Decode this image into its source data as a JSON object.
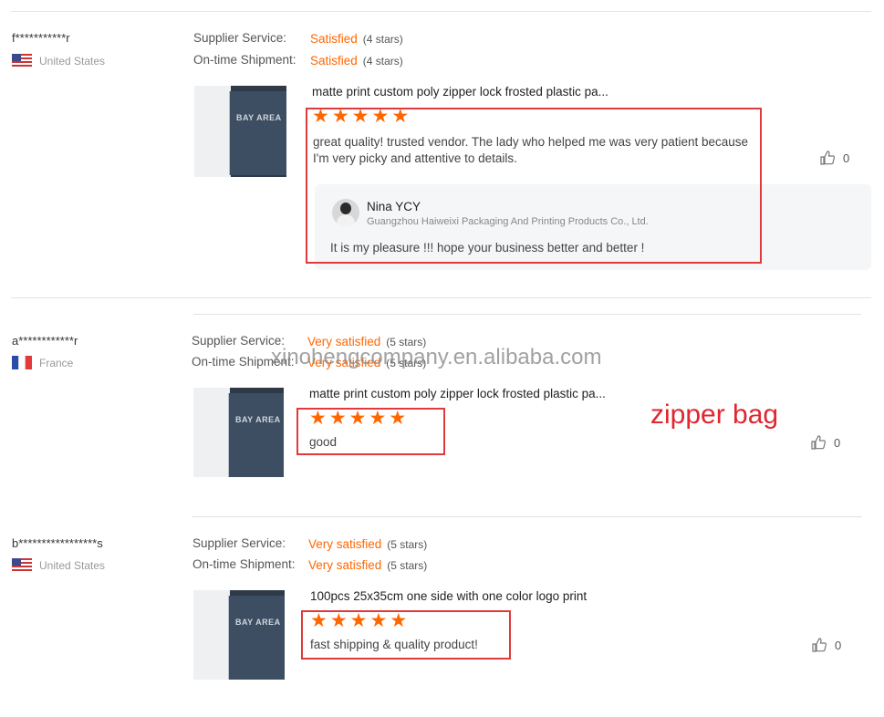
{
  "reviews": [
    {
      "user": "f***********r",
      "country": "United States",
      "supplier_service_label": "Supplier Service:",
      "supplier_service_value": "Satisfied",
      "supplier_service_stars": "(4 stars)",
      "shipment_label": "On-time Shipment:",
      "shipment_value": "Satisfied",
      "shipment_stars": "(4 stars)",
      "product_title": "matte print custom poly zipper lock frosted plastic pa...",
      "rating": 5,
      "text": "great quality! trusted vendor. The lady who helped me was very patient because I'm very picky and attentive to details.",
      "likes": "0",
      "reply": {
        "name": "Nina YCY",
        "company": "Guangzhou Haiweixi Packaging And Printing Products Co., Ltd.",
        "text": "It is my pleasure !!! hope your business better and better !"
      }
    },
    {
      "user": "a************r",
      "country": "France",
      "supplier_service_label": "Supplier Service:",
      "supplier_service_value": "Very satisfied",
      "supplier_service_stars": "(5 stars)",
      "shipment_label": "On-time Shipment:",
      "shipment_value": "Very satisfied",
      "shipment_stars": "(5 stars)",
      "product_title": "matte print custom poly zipper lock frosted plastic pa...",
      "rating": 5,
      "text": "good",
      "likes": "0"
    },
    {
      "user": "b*****************s",
      "country": "United States",
      "supplier_service_label": "Supplier Service:",
      "supplier_service_value": "Very satisfied",
      "supplier_service_stars": "(5 stars)",
      "shipment_label": "On-time Shipment:",
      "shipment_value": "Very satisfied",
      "shipment_stars": "(5 stars)",
      "product_title": "100pcs 25x35cm one side with one color logo print",
      "rating": 5,
      "text": "fast shipping & quality product!",
      "likes": "0"
    }
  ],
  "thumbnail_logo": "BAY AREA",
  "watermark": "xinohengcompany.en.alibaba.com",
  "annotation": "zipper bag",
  "colors": {
    "rating": "#ff6600",
    "annotation": "#e0262f"
  }
}
